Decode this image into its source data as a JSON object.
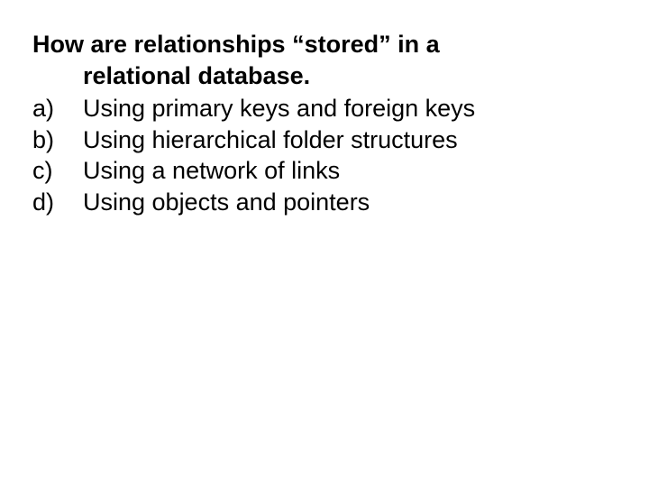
{
  "question": {
    "line1": "How are relationships “stored” in a",
    "line2": "relational database."
  },
  "options": [
    {
      "label": "a)",
      "text": "Using primary keys and foreign keys"
    },
    {
      "label": "b)",
      "text": "Using hierarchical folder structures"
    },
    {
      "label": "c)",
      "text": "Using a network of links"
    },
    {
      "label": "d)",
      "text": "Using objects and pointers"
    }
  ]
}
